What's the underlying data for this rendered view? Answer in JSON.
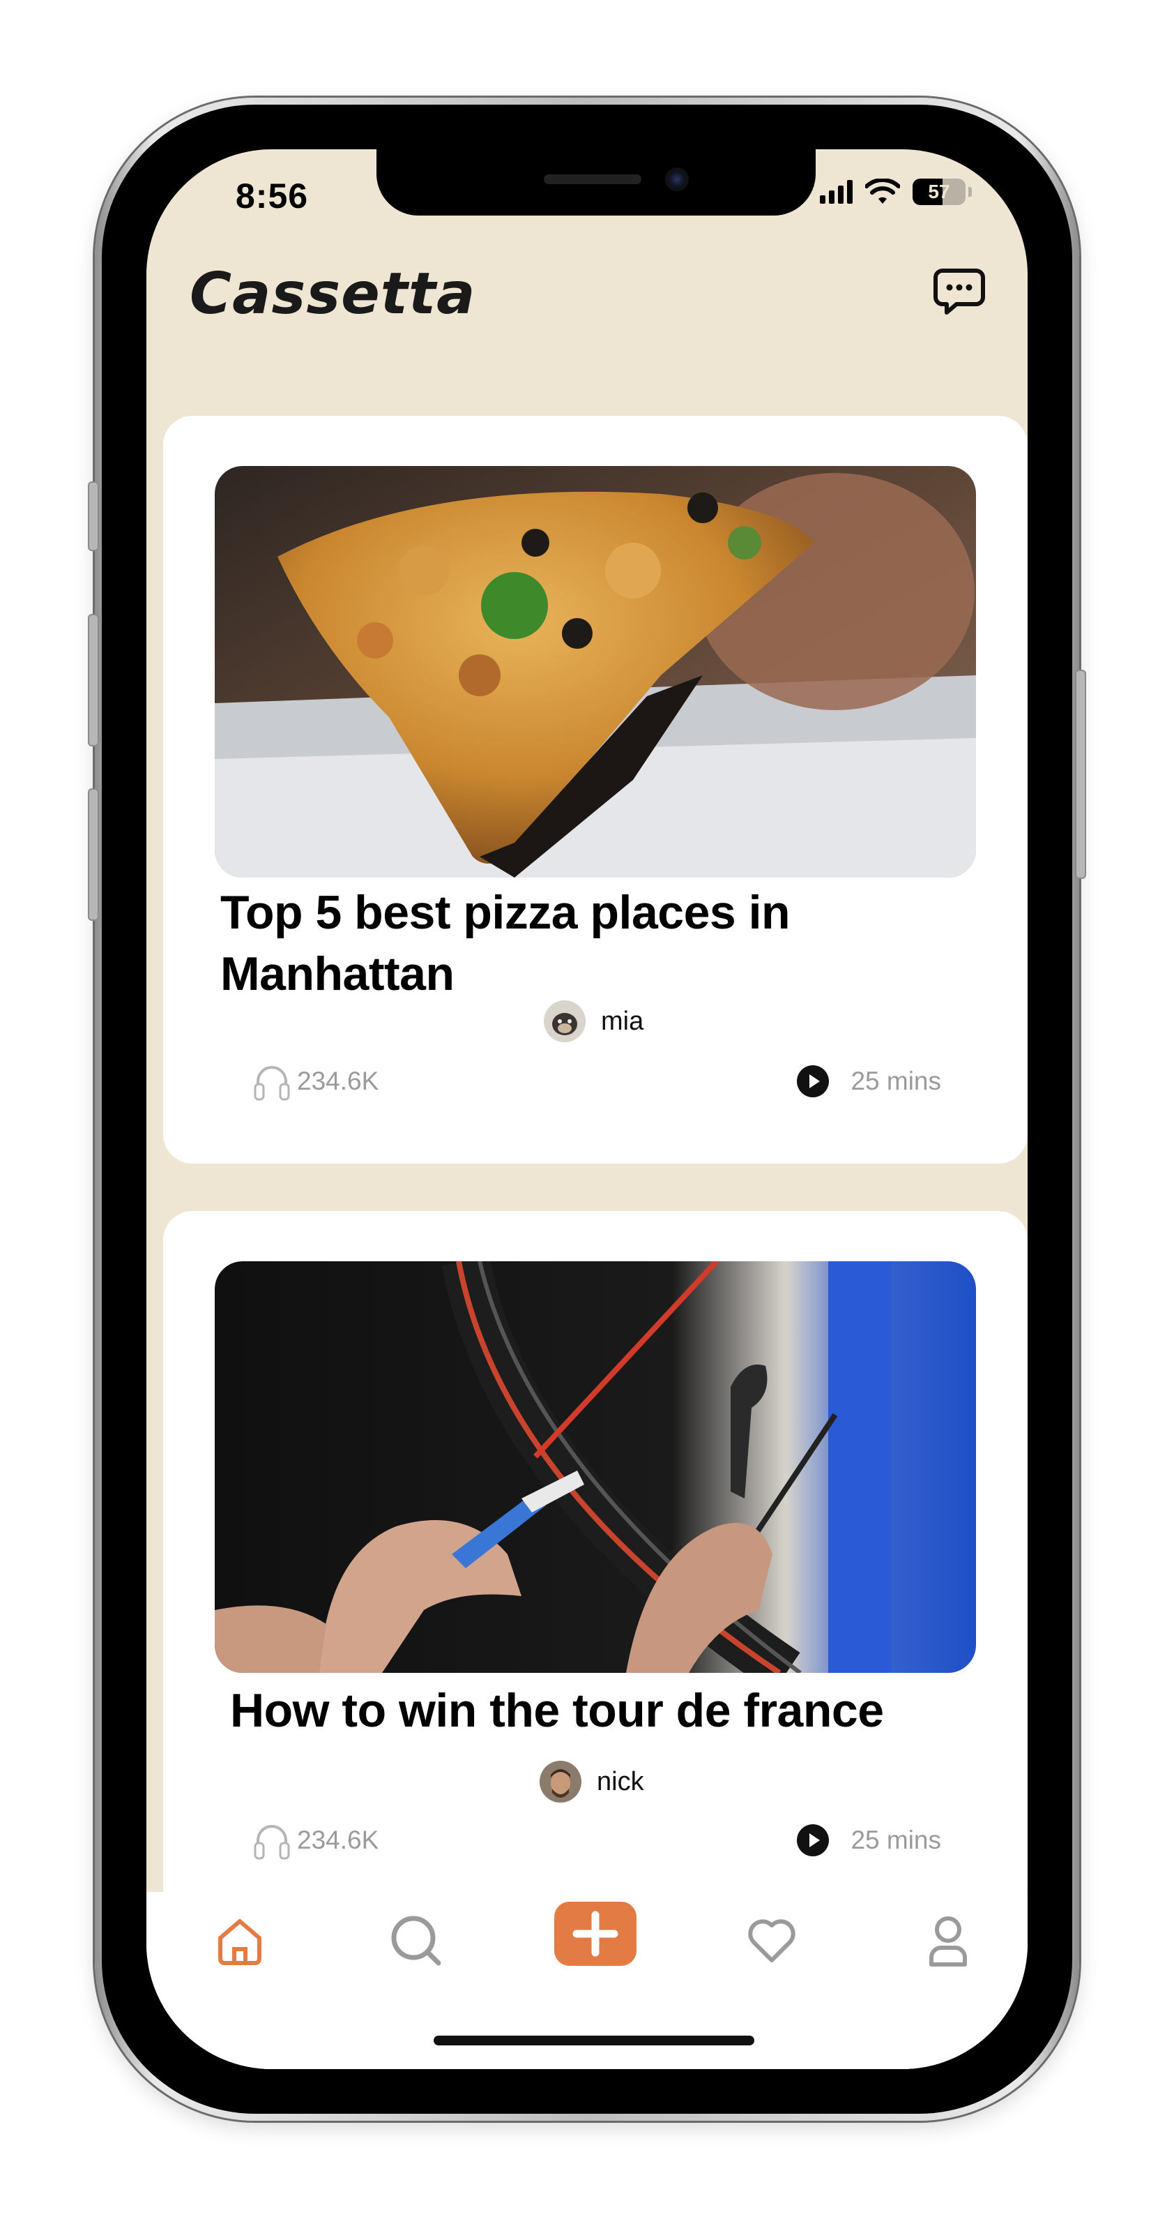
{
  "status_bar": {
    "time": "8:56",
    "battery": "57",
    "battery_level": 0.57
  },
  "header": {
    "app_title": "Cassetta",
    "chat_icon": "chat-bubble-icon"
  },
  "feed": [
    {
      "title": "Top 5 best pizza places in Manhattan",
      "author": "mia",
      "listens": "234.6K",
      "duration": "25 mins",
      "image": "pizza-slice-photo"
    },
    {
      "title": "How to win the tour de france",
      "author": "nick",
      "listens": "234.6K",
      "duration": "25 mins",
      "image": "bicycle-wheel-photo"
    }
  ],
  "tabbar": {
    "tabs": [
      "home-icon",
      "search-icon",
      "add-icon",
      "heart-icon",
      "profile-icon"
    ],
    "active": "home-icon",
    "accent_color": "#e37b45",
    "inactive_color": "#9a9a9a"
  },
  "colors": {
    "background": "#efe5d3",
    "card": "#ffffff",
    "accent": "#e37b45"
  }
}
